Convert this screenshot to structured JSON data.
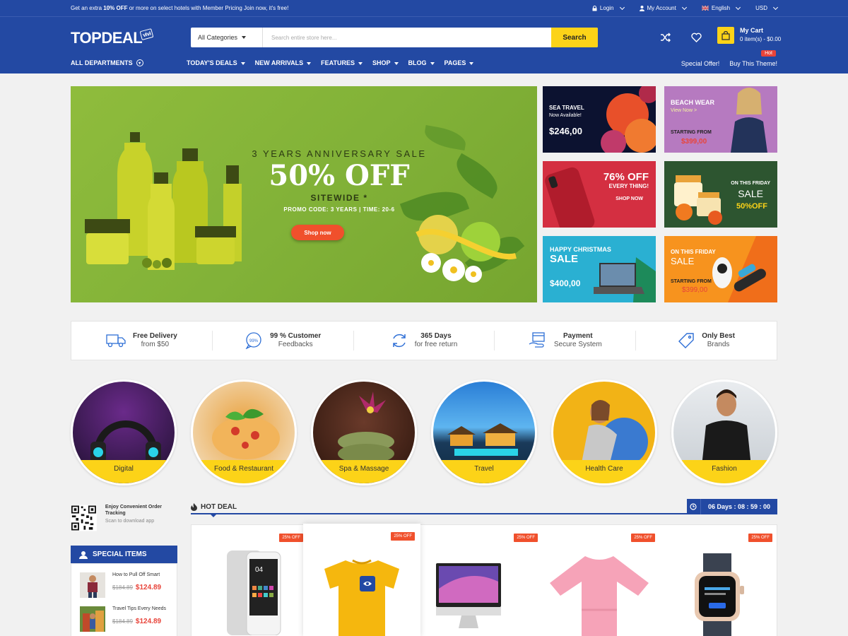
{
  "topbar": {
    "promo_prefix": "Get an extra ",
    "promo_bold": "10% OFF",
    "promo_suffix": " or more on select hotels with Member Pricing Join now, it's free!",
    "login": "Login",
    "account": "My Account",
    "language": "English",
    "currency": "USD"
  },
  "header": {
    "logo": "TOPDEAL",
    "logo_tag": "vivi",
    "search_category": "All Categories",
    "search_placeholder": "Search entire store here...",
    "search_button": "Search",
    "cart_title": "My Cart",
    "cart_summary": "0 item(s) - $0.00"
  },
  "nav": {
    "all_departments": "ALL DEPARTMENTS",
    "items": [
      "TODAY'S DEALS",
      "NEW ARRIVALS",
      "FEATURES",
      "SHOP",
      "BLOG",
      "PAGES"
    ],
    "special_offer": "Special Offer!",
    "buy_theme": "Buy This Theme!",
    "hot": "Hot"
  },
  "hero": {
    "line1": "3 YEARS ANNIVERSARY SALE",
    "line2": "50% OFF",
    "line3": "SITEWIDE *",
    "line4": "PROMO CODE: 3 YEARS | TIME: 20-6",
    "button": "Shop now"
  },
  "tiles": {
    "sea": {
      "title": "SEA TRAVEL",
      "sub": "Now Available!",
      "price": "$246,00"
    },
    "beach": {
      "title": "BEACH WEAR",
      "sub": "View Now >",
      "from": "STARTING FROM",
      "price": "$399,00"
    },
    "phone": {
      "pct": "76% OFF",
      "sub": "EVERY THING!",
      "link": "SHOP NOW"
    },
    "spa": {
      "t1": "ON THIS FRIDAY",
      "t2": "SALE",
      "t3": "50%OFF"
    },
    "christmas": {
      "t1": "HAPPY CHRISTMAS",
      "t2": "SALE",
      "price": "$400,00"
    },
    "friday": {
      "t1": "ON THIS FRIDAY",
      "t2": "SALE",
      "from": "STARTING FROM",
      "price": "$399,00"
    }
  },
  "features": [
    {
      "icon": "truck-icon",
      "title": "Free Delivery",
      "sub": "from $50"
    },
    {
      "icon": "feedback-icon",
      "title": "99 % Customer",
      "sub": "Feedbacks",
      "badge": "99%"
    },
    {
      "icon": "refresh-icon",
      "title": "365 Days",
      "sub": "for free return"
    },
    {
      "icon": "payment-icon",
      "title": "Payment",
      "sub": "Secure System"
    },
    {
      "icon": "tag-icon",
      "title": "Only Best",
      "sub": "Brands"
    }
  ],
  "categories": [
    "Digital",
    "Food & Restaurant",
    "Spa & Massage",
    "Travel",
    "Health Care",
    "Fashion"
  ],
  "sidebar": {
    "qr_title": "Enjoy Convenient Order Tracking",
    "qr_sub": "Scan to download app",
    "special_title": "SPECIAL ITEMS",
    "items": [
      {
        "name": "How to Pull Off Smart",
        "old": "$184.89",
        "price": "$124.89"
      },
      {
        "name": "Travel Tips Every Needs",
        "old": "$184.89",
        "price": "$124.89"
      }
    ]
  },
  "hotdeal": {
    "title": "HOT DEAL",
    "countdown": "06 Days : 08 : 59 : 00",
    "badge": "25% OFF"
  },
  "colors": {
    "brand_blue": "#2349a3",
    "accent_yellow": "#fcd318",
    "sale_red": "#e8443a"
  }
}
